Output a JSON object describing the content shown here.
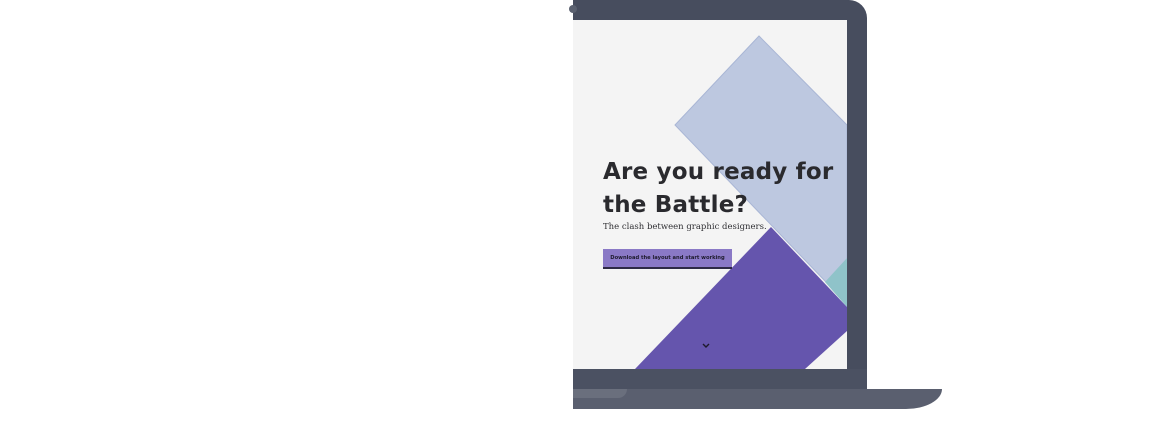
{
  "hero": {
    "title": "Are you ready for the Battle?",
    "subtitle": "The clash between graphic designers.",
    "cta_label": "Download the layout and start working"
  },
  "icons": {
    "scroll_indicator": "chevron-down-icon"
  },
  "colors": {
    "laptop_frame": "#474d5e",
    "laptop_base": "#5a5f6f",
    "screen_background": "#f4f4f4",
    "shape_periwinkle": "#bdc8e0",
    "shape_purple": "#6555ad",
    "shape_teal": "#8fc3c9",
    "cta_background": "#8a79c6",
    "title_text": "#2a2a2e"
  }
}
